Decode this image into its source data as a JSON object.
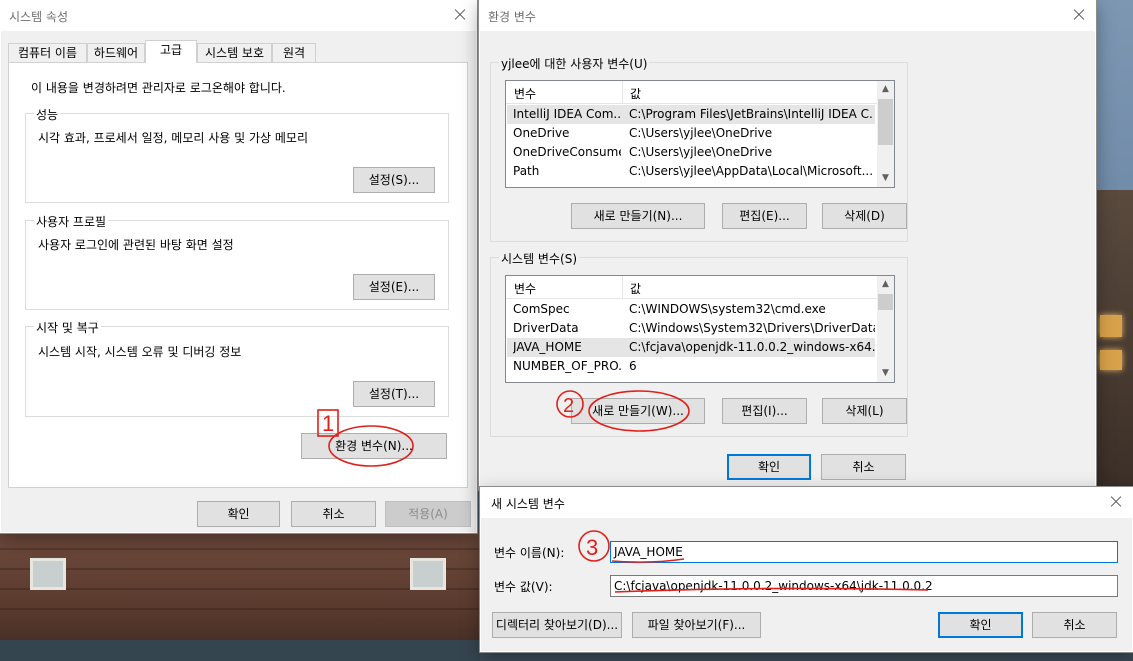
{
  "sysprops": {
    "title": "시스템 속성",
    "tabs": [
      "컴퓨터 이름",
      "하드웨어",
      "고급",
      "시스템 보호",
      "원격"
    ],
    "admin_note": "이 내용을 변경하려면 관리자로 로그온해야 합니다.",
    "groups": [
      {
        "label": "성능",
        "desc": "시각 효과, 프로세서 일정, 메모리 사용 및 가상 메모리",
        "button": "설정(S)..."
      },
      {
        "label": "사용자 프로필",
        "desc": "사용자 로그인에 관련된 바탕 화면 설정",
        "button": "설정(E)..."
      },
      {
        "label": "시작 및 복구",
        "desc": "시스템 시작, 시스템 오류 및 디버깅 정보",
        "button": "설정(T)..."
      }
    ],
    "env_button": "환경 변수(N)...",
    "ok": "확인",
    "cancel": "취소",
    "apply": "적용(A)"
  },
  "envvars": {
    "title": "환경 변수",
    "user_group": "yjlee에 대한 사용자 변수(U)",
    "columns": [
      "변수",
      "값"
    ],
    "user_vars": [
      {
        "name": "IntelliJ IDEA Com...",
        "value": "C:\\Program Files\\JetBrains\\IntelliJ IDEA C..."
      },
      {
        "name": "OneDrive",
        "value": "C:\\Users\\yjlee\\OneDrive"
      },
      {
        "name": "OneDriveConsumer",
        "value": "C:\\Users\\yjlee\\OneDrive"
      },
      {
        "name": "Path",
        "value": "C:\\Users\\yjlee\\AppData\\Local\\Microsoft..."
      }
    ],
    "user_buttons": {
      "new": "새로 만들기(N)...",
      "edit": "편집(E)...",
      "delete": "삭제(D)"
    },
    "system_group": "시스템 변수(S)",
    "system_vars": [
      {
        "name": "ComSpec",
        "value": "C:\\WINDOWS\\system32\\cmd.exe"
      },
      {
        "name": "DriverData",
        "value": "C:\\Windows\\System32\\Drivers\\DriverData"
      },
      {
        "name": "JAVA_HOME",
        "value": "C:\\fcjava\\openjdk-11.0.0.2_windows-x64..."
      },
      {
        "name": "NUMBER_OF_PRO...",
        "value": "6"
      }
    ],
    "system_buttons": {
      "new": "새로 만들기(W)...",
      "edit": "편집(I)...",
      "delete": "삭제(L)"
    },
    "ok": "확인",
    "cancel": "취소"
  },
  "newvar": {
    "title": "새 시스템 변수",
    "name_label": "변수 이름(N):",
    "name_value": "JAVA_HOME",
    "value_label": "변수 값(V):",
    "value_value": "C:\\fcjava\\openjdk-11.0.0.2_windows-x64\\jdk-11.0.0.2",
    "browse_dir": "디렉터리 찾아보기(D)...",
    "browse_file": "파일 찾아보기(F)...",
    "ok": "확인",
    "cancel": "취소"
  },
  "annotations": [
    "1",
    "2",
    "3"
  ],
  "colors": {
    "annotation": "#e0201b",
    "focus": "#0078d7"
  }
}
